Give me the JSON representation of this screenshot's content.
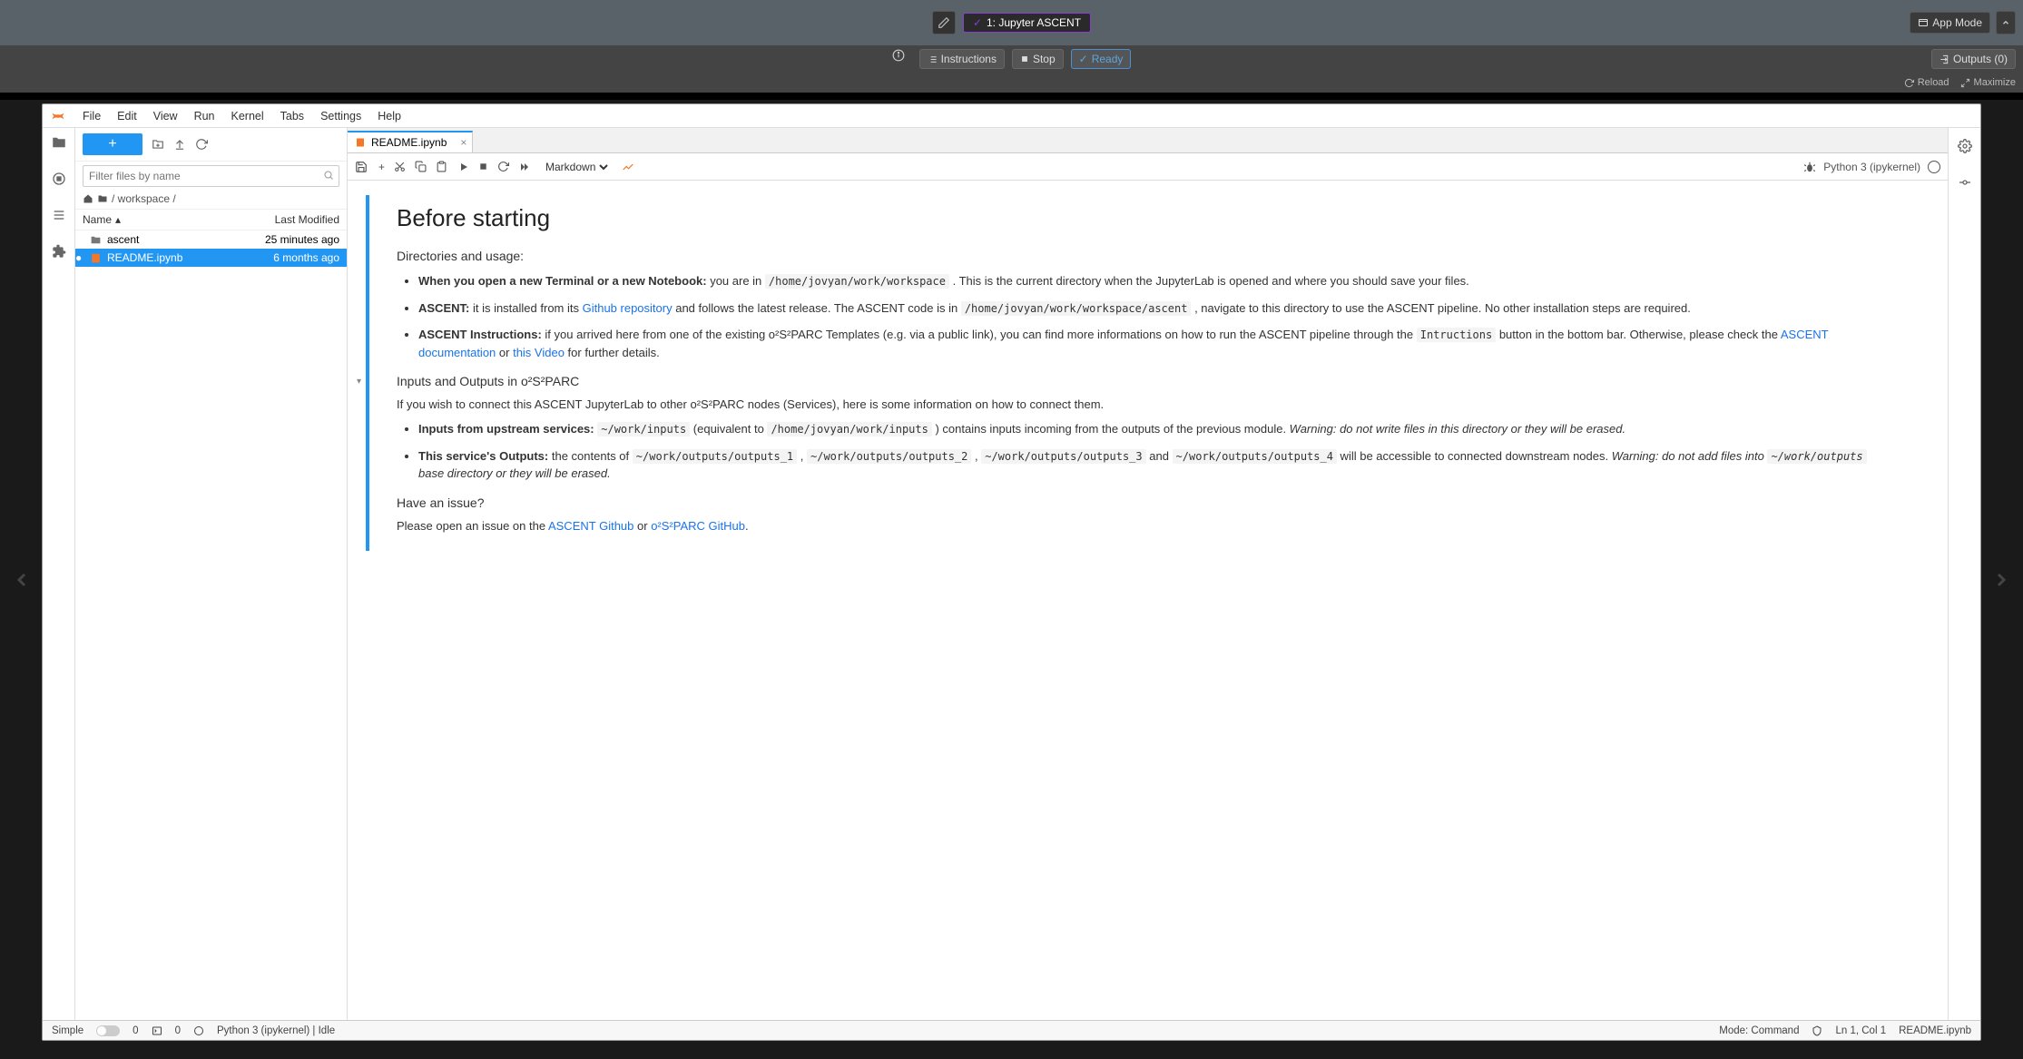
{
  "outerTop": {
    "jupyterTab": "1: Jupyter ASCENT",
    "appMode": "App Mode"
  },
  "toolbar2": {
    "instructions": "Instructions",
    "stop": "Stop",
    "ready": "Ready",
    "outputs": "Outputs (0)"
  },
  "toolbar3": {
    "reload": "Reload",
    "maximize": "Maximize"
  },
  "menubar": [
    "File",
    "Edit",
    "View",
    "Run",
    "Kernel",
    "Tabs",
    "Settings",
    "Help"
  ],
  "fileBrowser": {
    "filterPlaceholder": "Filter files by name",
    "crumb": "/ workspace /",
    "colName": "Name",
    "colModified": "Last Modified",
    "rows": [
      {
        "icon": "folder",
        "name": "ascent",
        "modified": "25 minutes ago",
        "selected": false
      },
      {
        "icon": "notebook",
        "name": "README.ipynb",
        "modified": "6 months ago",
        "selected": true
      }
    ]
  },
  "tab": {
    "label": "README.ipynb"
  },
  "nbToolbar": {
    "cellType": "Markdown",
    "kernelName": "Python 3 (ipykernel)"
  },
  "doc": {
    "h1": "Before starting",
    "dirHeading": "Directories and usage:",
    "li1_strong": "When you open a new Terminal or a new Notebook:",
    "li1_a": " you are in ",
    "li1_code": "/home/jovyan/work/workspace",
    "li1_b": " . This is the current directory when the JupyterLab is opened and where you should save your files.",
    "li2_strong": "ASCENT:",
    "li2_a": " it is installed from its ",
    "li2_link": "Github repository",
    "li2_b": " and follows the latest release. The ASCENT code is in ",
    "li2_code": "/home/jovyan/work/workspace/ascent",
    "li2_c": " , navigate to this directory to use the ASCENT pipeline. No other installation steps are required.",
    "li3_strong": "ASCENT Instructions:",
    "li3_a": " if you arrived here from one of the existing o²S²PARC Templates (e.g. via a public link), you can find more informations on how to run the ASCENT pipeline through the ",
    "li3_code": "Intructions",
    "li3_b": " button in the bottom bar. Otherwise, please check the ",
    "li3_link1": "ASCENT documentation",
    "li3_or": " or ",
    "li3_link2": "this Video",
    "li3_c": " for further details.",
    "h3_io": "Inputs and Outputs in o²S²PARC",
    "p_io": "If you wish to connect this ASCENT JupyterLab to other o²S²PARC nodes (Services), here is some information on how to connect them.",
    "li4_strong": "Inputs from upstream services:",
    "li4_code1": "~/work/inputs",
    "li4_a": " (equivalent to ",
    "li4_code2": "/home/jovyan/work/inputs",
    "li4_b": " ) contains inputs incoming from the outputs of the previous module. ",
    "li4_em": "Warning: do not write files in this directory or they will be erased.",
    "li5_strong": "This service's Outputs:",
    "li5_a": " the contents of ",
    "li5_code1": "~/work/outputs/outputs_1",
    "li5_sep1": " , ",
    "li5_code2": "~/work/outputs/outputs_2",
    "li5_sep2": " , ",
    "li5_code3": "~/work/outputs/outputs_3",
    "li5_and": " and ",
    "li5_code4": "~/work/outputs/outputs_4",
    "li5_b": " will be accessible to connected downstream nodes. ",
    "li5_em_a": "Warning: do not add files into ",
    "li5_em_code": "~/work/outputs",
    "li5_em_b": " base directory or they will be erased.",
    "h3_issue": "Have an issue?",
    "p_issue_a": "Please open an issue on the ",
    "p_issue_link1": "ASCENT Github",
    "p_issue_or": " or ",
    "p_issue_link2": "o²S²PARC GitHub",
    "p_issue_b": "."
  },
  "status": {
    "simple": "Simple",
    "zero1": "0",
    "zero2": "0",
    "kernel": "Python 3 (ipykernel) | Idle",
    "mode": "Mode: Command",
    "lncol": "Ln 1, Col 1",
    "file": "README.ipynb"
  }
}
